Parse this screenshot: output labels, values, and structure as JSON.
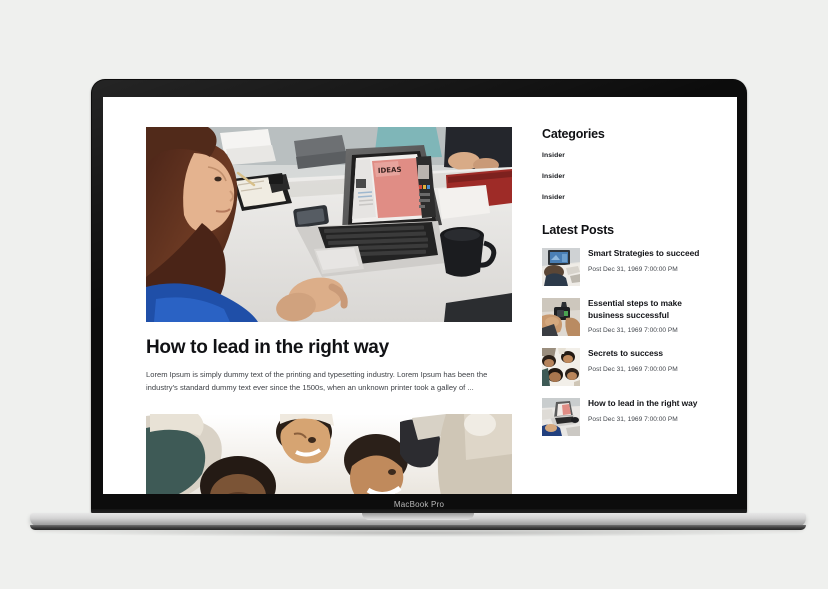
{
  "device": {
    "label": "MacBook Pro"
  },
  "page": {
    "article": {
      "title": "How to lead in the right way",
      "excerpt": "Lorem Ipsum is simply dummy text of the printing and typesetting industry. Lorem Ipsum has been the industry's standard dummy text ever since the 1500s, when an unknown printer took a galley of ...",
      "hero_image_alt": "woman-at-meeting-table-with-laptop-showing-ideas-design",
      "second_image_alt": "group-of-people-viewed-from-below"
    },
    "sidebar": {
      "categories_heading": "Categories",
      "categories": [
        {
          "label": "Insider"
        },
        {
          "label": "Insider"
        },
        {
          "label": "Insider"
        }
      ],
      "latest_posts_heading": "Latest Posts",
      "posts": [
        {
          "title": "Smart Strategies to succeed",
          "meta": "Post Dec 31, 1969 7:00:00 PM",
          "thumb_alt": "desk-with-monitor-and-person"
        },
        {
          "title": "Essential steps to make business successful",
          "meta": "Post Dec 31, 1969 7:00:00 PM",
          "thumb_alt": "hands-holding-camera-device"
        },
        {
          "title": "Secrets to success",
          "meta": "Post Dec 31, 1969 7:00:00 PM",
          "thumb_alt": "group-of-people-from-below"
        },
        {
          "title": "How to lead in the right way",
          "meta": "Post Dec 31, 1969 7:00:00 PM",
          "thumb_alt": "laptop-on-meeting-table"
        }
      ]
    }
  },
  "colors": {
    "page_background": "#eff0ee",
    "screen_background": "#ffffff",
    "bezel": "#0c0c0c",
    "heading_text": "#101114",
    "body_text": "#3f4247",
    "meta_text": "#44484e"
  }
}
